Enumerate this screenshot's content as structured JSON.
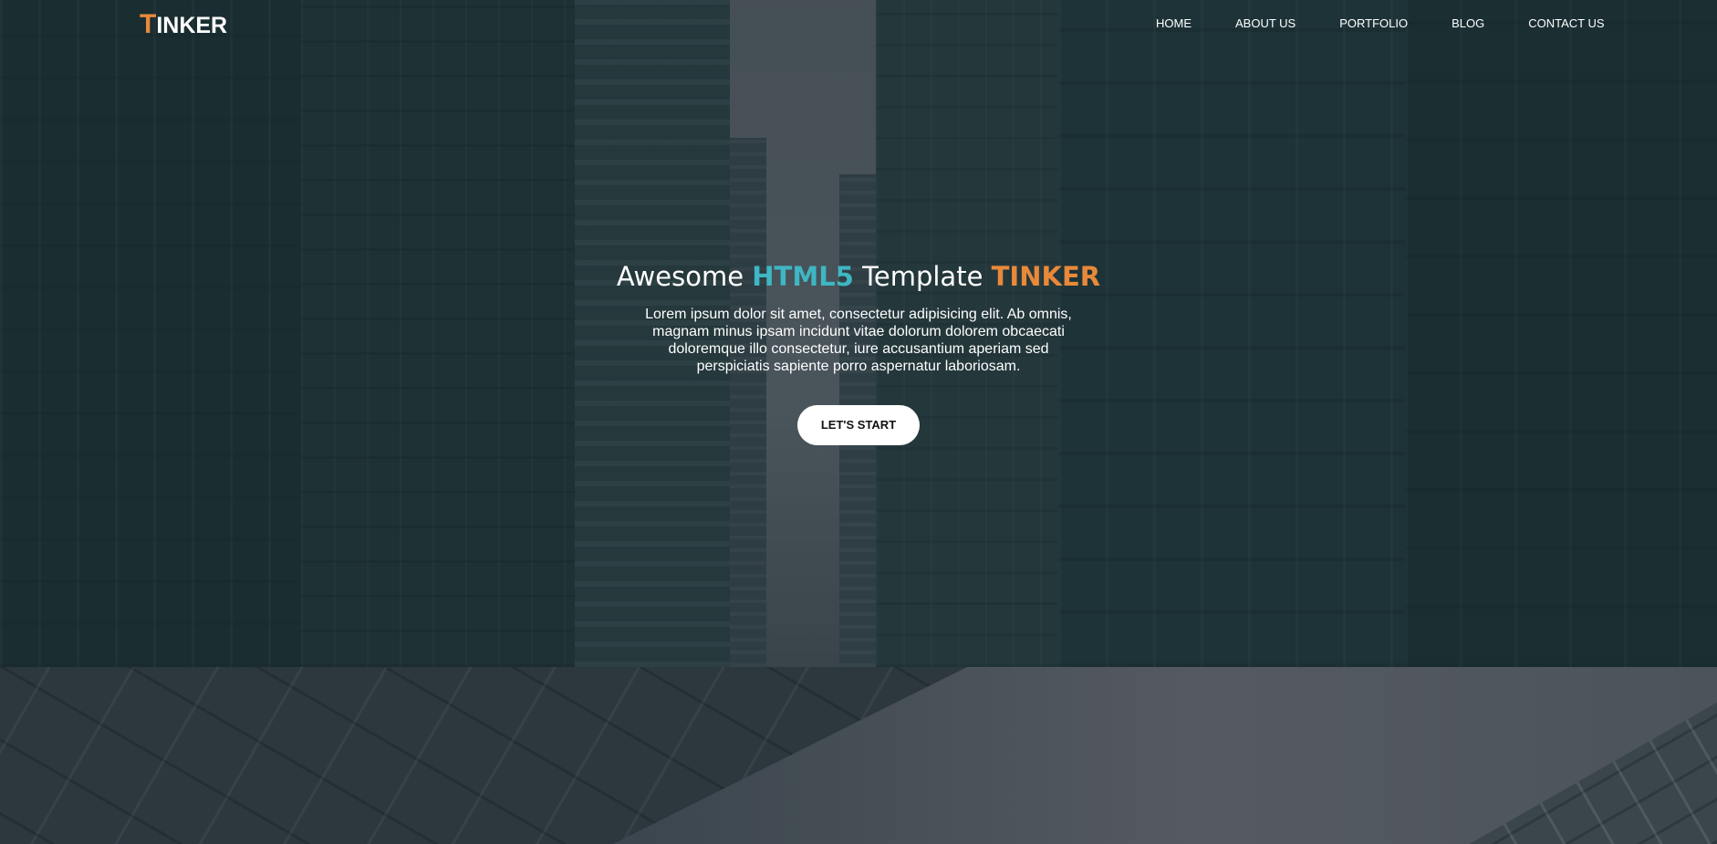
{
  "logo": {
    "first_letter": "T",
    "rest": "INKER"
  },
  "nav": {
    "items": [
      {
        "label": "HOME"
      },
      {
        "label": "ABOUT US"
      },
      {
        "label": "PORTFOLIO"
      },
      {
        "label": "BLOG"
      },
      {
        "label": "CONTACT US"
      }
    ]
  },
  "hero": {
    "title_part1": "Awesome ",
    "title_accent1": "HTML5",
    "title_part2": " Template ",
    "title_accent2": "TINKER",
    "text": "Lorem ipsum dolor sit amet, consectetur adipisicing elit. Ab omnis, magnam minus ipsam incidunt vitae dolorum dolorem obcaecati doloremque illo consectetur, iure accusantium aperiam sed perspiciatis sapiente porro aspernatur laboriosam.",
    "cta_label": "LET'S START"
  },
  "colors": {
    "accent_orange": "#e8893a",
    "accent_blue": "#3fb6c3",
    "text": "#ffffff"
  }
}
